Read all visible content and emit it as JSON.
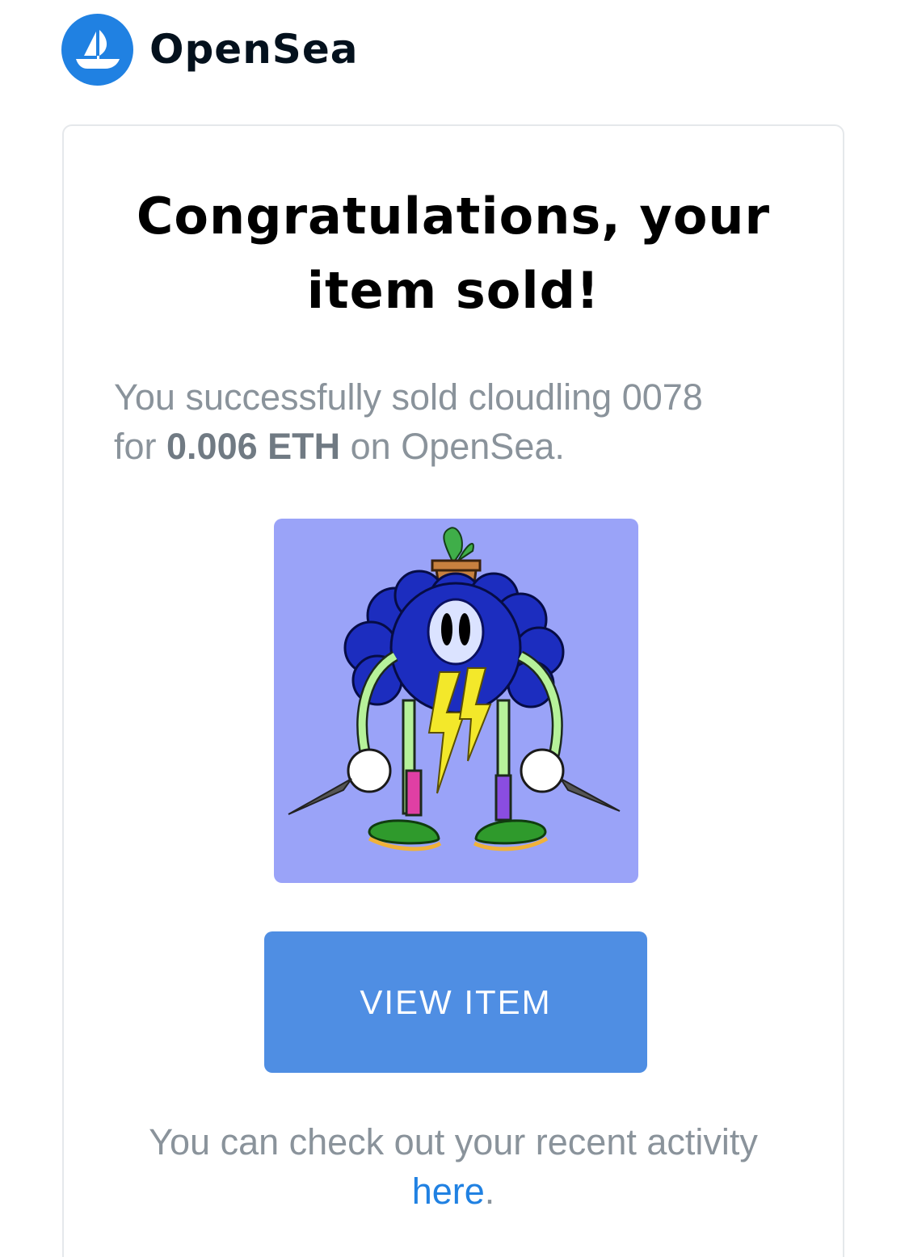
{
  "brand": {
    "name": "OpenSea",
    "color": "#2081e2"
  },
  "email": {
    "title_line1": "Congratulations, your",
    "title_line2": "item sold!",
    "message_prefix": "You successfully sold cloudling 0078",
    "message_for": "for ",
    "message_amount": "0.006 ETH",
    "message_suffix": " on OpenSea.",
    "nft_image_icon": "nft-image",
    "view_button_label": "VIEW ITEM",
    "footer_text": "You can check out your recent activity",
    "footer_link": "here",
    "footer_period": "."
  },
  "colors": {
    "button": "#4f8ee3",
    "nft_background": "#9aa3f8",
    "muted_text": "#8a939b"
  }
}
